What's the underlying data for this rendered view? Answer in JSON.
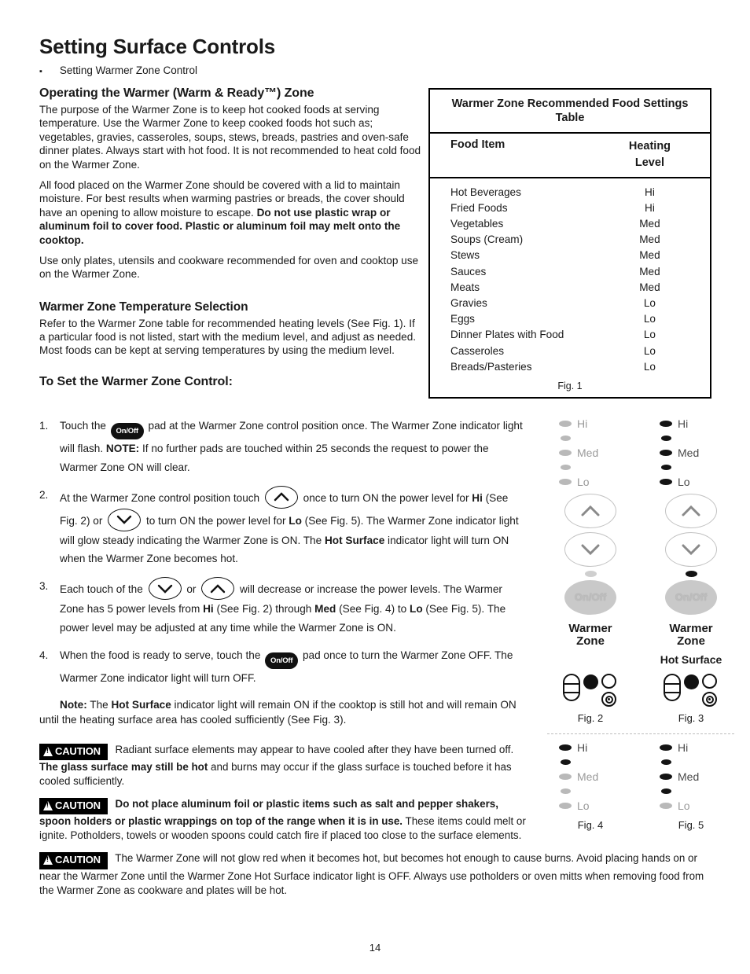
{
  "page": {
    "title": "Setting Surface Controls",
    "bullet": "Setting Warmer Zone Control",
    "page_number": "14"
  },
  "sections": {
    "operating": {
      "heading": "Operating the Warmer (Warm & Ready™) Zone",
      "p1": "The purpose of the Warmer Zone is to keep hot cooked foods at serving temperature. Use the Warmer Zone to keep cooked foods hot such as; vegetables, gravies, casseroles, soups, stews, breads, pastries and oven-safe dinner plates.  Always start with hot food. It is not recommended to heat cold food on the Warmer Zone.",
      "p2_a": "All food placed on the Warmer Zone should be covered with a lid to maintain moisture.  For best results when warming pastries or breads, the cover should have an opening to allow moisture to escape. ",
      "p2_bold": "Do not use plastic wrap or aluminum foil to cover food. Plastic or aluminum foil may melt onto the cooktop.",
      "p3": "Use only plates, utensils and cookware recommended for oven and cooktop use on the Warmer Zone."
    },
    "temp_selection": {
      "heading": "Warmer Zone Temperature Selection",
      "p1": "Refer to the Warmer Zone table for recommended heating levels (See Fig. 1). If a particular food is not listed, start with the medium level, and adjust as needed. Most foods can be kept at serving temperatures by using the medium level."
    },
    "to_set": {
      "heading": "To Set the Warmer Zone Control:"
    }
  },
  "steps": [
    {
      "num": "1.",
      "pad_label": "On/Off",
      "text_a": "Touch the ",
      "text_b": " pad at the Warmer Zone control position once. The Warmer Zone indicator light will flash. ",
      "note_bold": "NOTE:",
      "text_c": " If no further pads are touched within 25 seconds the request to power the Warmer Zone ON will clear."
    },
    {
      "num": "2.",
      "text_a": "At the Warmer Zone control position touch ",
      "text_b": " once to turn ON the power level for ",
      "bold_hi": "Hi",
      "text_c": " (See Fig. 2) or ",
      "text_d": " to turn ON the power level for ",
      "bold_lo": "Lo",
      "text_e": " (See Fig. 5). The Warmer Zone indicator light will glow steady indicating the Warmer Zone is ON. The ",
      "bold_hot": "Hot Surface",
      "text_f": " indicator light will turn ON when the Warmer Zone becomes hot."
    },
    {
      "num": "3.",
      "text_a": "Each touch of the ",
      "text_b": " or ",
      "text_c": " will decrease or increase the power levels. The Warmer Zone has 5 power levels from ",
      "bold_hi": "Hi",
      "text_d": " (See Fig. 2) through ",
      "bold_med": "Med",
      "text_e": " (See Fig. 4) to ",
      "bold_lo": "Lo",
      "text_f": " (See Fig. 5). The power level may be adjusted at any time while the Warmer Zone is ON."
    },
    {
      "num": "4.",
      "pad_label": "On/Off",
      "text_a": "When the food is ready to serve, touch the ",
      "text_b": " pad once to turn the Warmer Zone OFF. The Warmer Zone indicator light will turn OFF."
    }
  ],
  "note": {
    "label": "Note:",
    "text_a": " The ",
    "bold": "Hot Surface",
    "text_b": " indicator light will remain ON if the cooktop is still hot and will remain ON until the heating surface area has cooled sufficiently (See Fig. 3)."
  },
  "cautions": [
    {
      "badge": "CAUTION",
      "text_a": " Radiant surface elements may appear to have cooled after they have been turned off. ",
      "bold": "The glass surface may still be hot",
      "text_b": " and burns may occur if the glass surface is touched before it has cooled sufficiently."
    },
    {
      "badge": "CAUTION",
      "bold_lead": "  Do not place aluminum foil or plastic items such as salt and pepper shakers, spoon holders or plastic wrappings on top of the range when it is in use.",
      "text_b": " These items could melt or ignite. Potholders, towels or wooden spoons could catch fire if placed too close to the surface elements."
    },
    {
      "badge": "CAUTION",
      "text_a": " The Warmer Zone will not glow red when it becomes hot, but becomes hot enough to cause burns. Avoid placing hands on or near the Warmer Zone until the Warmer Zone Hot Surface indicator light is OFF. Always use potholders or oven mitts when removing food from the Warmer Zone as cookware and plates will be hot."
    }
  ],
  "table": {
    "title": "Warmer Zone Recommended Food Settings Table",
    "headers": {
      "col1": "Food Item",
      "col2_line1": "Heating",
      "col2_line2": "Level"
    },
    "rows": [
      {
        "item": "Hot Beverages",
        "level": "Hi"
      },
      {
        "item": "Fried Foods",
        "level": "Hi"
      },
      {
        "item": "Vegetables",
        "level": "Med"
      },
      {
        "item": "Soups (Cream)",
        "level": "Med"
      },
      {
        "item": "Stews",
        "level": "Med"
      },
      {
        "item": "Sauces",
        "level": "Med"
      },
      {
        "item": "Meats",
        "level": "Med"
      },
      {
        "item": "Gravies",
        "level": "Lo"
      },
      {
        "item": "Eggs",
        "level": "Lo"
      },
      {
        "item": "Dinner Plates with Food",
        "level": "Lo"
      },
      {
        "item": "Casseroles",
        "level": "Lo"
      },
      {
        "item": "Breads/Pasteries",
        "level": "Lo"
      }
    ],
    "caption": "Fig. 1"
  },
  "figures": {
    "level_labels": {
      "hi": "Hi",
      "med": "Med",
      "lo": "Lo"
    },
    "onoff_label": "On/Off",
    "zone_label_line1": "Warmer",
    "zone_label_line2": "Zone",
    "hot_surface_label": "Hot Surface",
    "fig2": {
      "caption": "Fig. 2",
      "indicators": [
        "off",
        "off",
        "off",
        "off",
        "off"
      ],
      "small_dot": "off",
      "hot_surface_shown": false
    },
    "fig3": {
      "caption": "Fig. 3",
      "indicators": [
        "on",
        "on",
        "on",
        "on",
        "on"
      ],
      "small_dot": "on",
      "hot_surface_shown": true
    },
    "fig4": {
      "caption": "Fig. 4",
      "indicators": [
        "on",
        "on",
        "off",
        "off",
        "off"
      ]
    },
    "fig5": {
      "caption": "Fig. 5",
      "indicators": [
        "on",
        "on",
        "on",
        "on",
        "off"
      ]
    }
  }
}
